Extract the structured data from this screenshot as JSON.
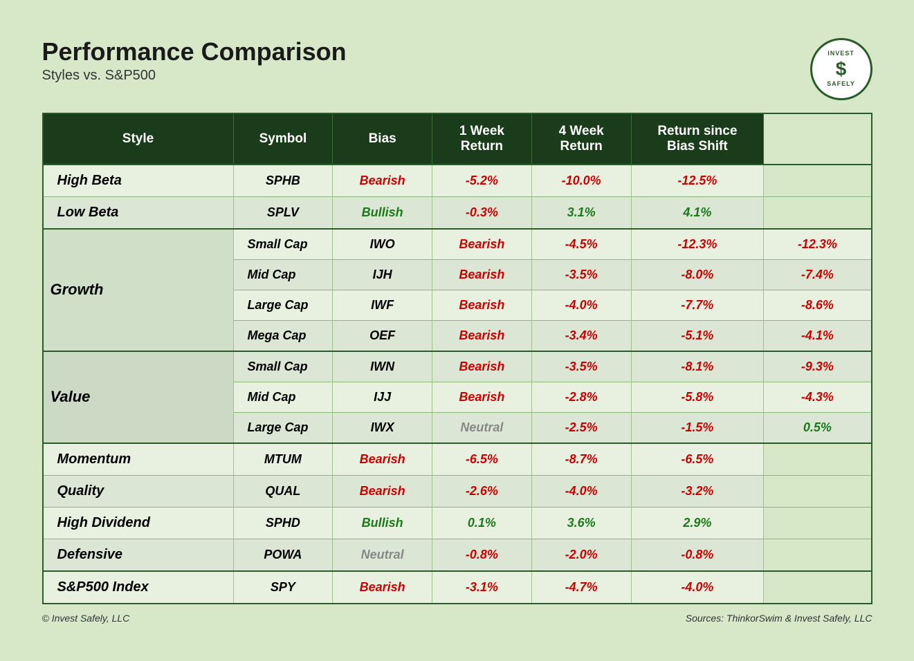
{
  "header": {
    "title": "Performance Comparison",
    "subtitle": "Styles vs. S&P500",
    "logo_top": "INVEST",
    "logo_bottom": "SAFELY",
    "logo_symbol": "$"
  },
  "table": {
    "columns": [
      "Style",
      "Symbol",
      "Bias",
      "1 Week Return",
      "4 Week Return",
      "Return since Bias Shift"
    ],
    "rows": [
      {
        "style": "High Beta",
        "style_type": "main",
        "symbol": "SPHB",
        "bias": "Bearish",
        "bias_color": "red",
        "week1": "-5.2%",
        "week1_color": "red",
        "week4": "-10.0%",
        "week4_color": "red",
        "since_bias": "-12.5%",
        "since_bias_color": "red",
        "section_start": true
      },
      {
        "style": "Low Beta",
        "style_type": "main",
        "symbol": "SPLV",
        "bias": "Bullish",
        "bias_color": "green",
        "week1": "-0.3%",
        "week1_color": "red",
        "week4": "3.1%",
        "week4_color": "green",
        "since_bias": "4.1%",
        "since_bias_color": "green",
        "section_start": false
      },
      {
        "style": "Growth",
        "style_type": "group",
        "sub_style": "Small Cap",
        "symbol": "IWO",
        "bias": "Bearish",
        "bias_color": "red",
        "week1": "-4.5%",
        "week1_color": "red",
        "week4": "-12.3%",
        "week4_color": "red",
        "since_bias": "-12.3%",
        "since_bias_color": "red",
        "section_start": true,
        "rowspan": 4
      },
      {
        "style": "",
        "style_type": "sub",
        "sub_style": "Mid Cap",
        "symbol": "IJH",
        "bias": "Bearish",
        "bias_color": "red",
        "week1": "-3.5%",
        "week1_color": "red",
        "week4": "-8.0%",
        "week4_color": "red",
        "since_bias": "-7.4%",
        "since_bias_color": "red",
        "section_start": false
      },
      {
        "style": "",
        "style_type": "sub",
        "sub_style": "Large Cap",
        "symbol": "IWF",
        "bias": "Bearish",
        "bias_color": "red",
        "week1": "-4.0%",
        "week1_color": "red",
        "week4": "-7.7%",
        "week4_color": "red",
        "since_bias": "-8.6%",
        "since_bias_color": "red",
        "section_start": false
      },
      {
        "style": "",
        "style_type": "sub",
        "sub_style": "Mega Cap",
        "symbol": "OEF",
        "bias": "Bearish",
        "bias_color": "red",
        "week1": "-3.4%",
        "week1_color": "red",
        "week4": "-5.1%",
        "week4_color": "red",
        "since_bias": "-4.1%",
        "since_bias_color": "red",
        "section_start": false
      },
      {
        "style": "Value",
        "style_type": "group",
        "sub_style": "Small Cap",
        "symbol": "IWN",
        "bias": "Bearish",
        "bias_color": "red",
        "week1": "-3.5%",
        "week1_color": "red",
        "week4": "-8.1%",
        "week4_color": "red",
        "since_bias": "-9.3%",
        "since_bias_color": "red",
        "section_start": true,
        "rowspan": 3
      },
      {
        "style": "",
        "style_type": "sub",
        "sub_style": "Mid Cap",
        "symbol": "IJJ",
        "bias": "Bearish",
        "bias_color": "red",
        "week1": "-2.8%",
        "week1_color": "red",
        "week4": "-5.8%",
        "week4_color": "red",
        "since_bias": "-4.3%",
        "since_bias_color": "red",
        "section_start": false
      },
      {
        "style": "",
        "style_type": "sub",
        "sub_style": "Large Cap",
        "symbol": "IWX",
        "bias": "Neutral",
        "bias_color": "gray",
        "week1": "-2.5%",
        "week1_color": "red",
        "week4": "-1.5%",
        "week4_color": "red",
        "since_bias": "0.5%",
        "since_bias_color": "green",
        "section_start": false
      },
      {
        "style": "Momentum",
        "style_type": "main",
        "symbol": "MTUM",
        "bias": "Bearish",
        "bias_color": "red",
        "week1": "-6.5%",
        "week1_color": "red",
        "week4": "-8.7%",
        "week4_color": "red",
        "since_bias": "-6.5%",
        "since_bias_color": "red",
        "section_start": true
      },
      {
        "style": "Quality",
        "style_type": "main",
        "symbol": "QUAL",
        "bias": "Bearish",
        "bias_color": "red",
        "week1": "-2.6%",
        "week1_color": "red",
        "week4": "-4.0%",
        "week4_color": "red",
        "since_bias": "-3.2%",
        "since_bias_color": "red",
        "section_start": false
      },
      {
        "style": "High Dividend",
        "style_type": "main",
        "symbol": "SPHD",
        "bias": "Bullish",
        "bias_color": "green",
        "week1": "0.1%",
        "week1_color": "green",
        "week4": "3.6%",
        "week4_color": "green",
        "since_bias": "2.9%",
        "since_bias_color": "green",
        "section_start": false
      },
      {
        "style": "Defensive",
        "style_type": "main",
        "symbol": "POWA",
        "bias": "Neutral",
        "bias_color": "gray",
        "week1": "-0.8%",
        "week1_color": "red",
        "week4": "-2.0%",
        "week4_color": "red",
        "since_bias": "-0.8%",
        "since_bias_color": "red",
        "section_start": false
      },
      {
        "style": "S&P500 Index",
        "style_type": "main",
        "symbol": "SPY",
        "bias": "Bearish",
        "bias_color": "red",
        "week1": "-3.1%",
        "week1_color": "red",
        "week4": "-4.7%",
        "week4_color": "red",
        "since_bias": "-4.0%",
        "since_bias_color": "red",
        "section_start": true
      }
    ]
  },
  "footer": {
    "left": "© Invest Safely, LLC",
    "right": "Sources: ThinkorSwim & Invest Safely, LLC"
  },
  "colors": {
    "header_bg": "#1a3c1a",
    "table_border": "#2a5c2a",
    "red": "#cc0000",
    "green": "#1a7a1a",
    "gray": "#888888"
  }
}
